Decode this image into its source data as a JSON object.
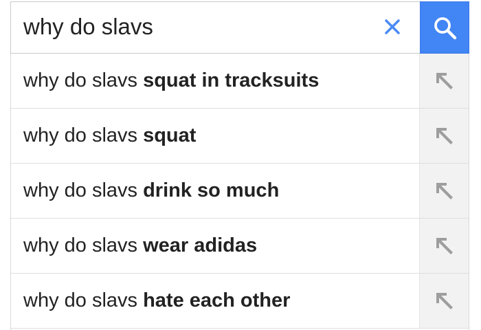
{
  "search": {
    "query": "why do slavs",
    "clear_icon": "close-icon",
    "search_icon": "search-icon",
    "button_color": "#4285f4"
  },
  "suggestions": [
    {
      "prefix": "why do slavs",
      "completion": "squat in tracksuits",
      "icon": "arrow-up-left-icon"
    },
    {
      "prefix": "why do slavs",
      "completion": "squat",
      "icon": "arrow-up-left-icon"
    },
    {
      "prefix": "why do slavs",
      "completion": "drink so much",
      "icon": "arrow-up-left-icon"
    },
    {
      "prefix": "why do slavs",
      "completion": "wear adidas",
      "icon": "arrow-up-left-icon"
    },
    {
      "prefix": "why do slavs",
      "completion": "hate each other",
      "icon": "arrow-up-left-icon"
    }
  ]
}
